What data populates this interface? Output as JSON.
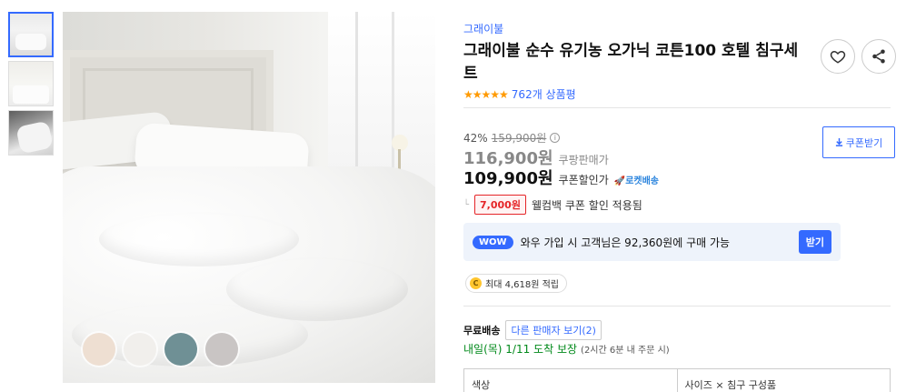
{
  "gallery": {
    "thumbnails": [
      {
        "alt": "thumbnail-1",
        "selected": true
      },
      {
        "alt": "thumbnail-2",
        "selected": false
      },
      {
        "alt": "thumbnail-3",
        "selected": false
      }
    ],
    "color_swatches": [
      "#eedfd2",
      "#f1efec",
      "#6f9095",
      "#c9c5c4"
    ]
  },
  "product": {
    "brand": "그래이불",
    "title": "그래이불 순수 유기농 오가닉 코튼100 호텔 침구세트",
    "stars": "★★★★★",
    "review_count": "762개 상품평",
    "rating_color": "#ff9a00"
  },
  "pricing": {
    "discount": "42%",
    "original_price": "159,900원",
    "info_icon": "i",
    "coupon_download": "쿠폰받기",
    "sale_price": "116,900원",
    "sale_label": "쿠팡판매가",
    "coupon_price": "109,900원",
    "coupon_label": "쿠폰할인가",
    "rocket_label": "🚀로켓배송",
    "corner_mark": "└",
    "welcome_tag": "7,000원",
    "welcome_text": "웰컴백 쿠폰 할인 적용됨"
  },
  "wow": {
    "badge": "WOW",
    "text": "와우 가입 시 고객님은 92,360원에 구매 가능",
    "button": "받기"
  },
  "cash": {
    "coin": "C",
    "text": "최대 4,618원 적립"
  },
  "shipping": {
    "free": "무료배송",
    "other_seller": "다른 판매자 보기(2)",
    "arrival": "내일(목) 1/11 도착 보장",
    "arrival_note": "(2시간 6분 내 주문 시)"
  },
  "options": {
    "col1": "색상",
    "col2": "사이즈 × 침구 구성품"
  },
  "accent": "#346aff"
}
